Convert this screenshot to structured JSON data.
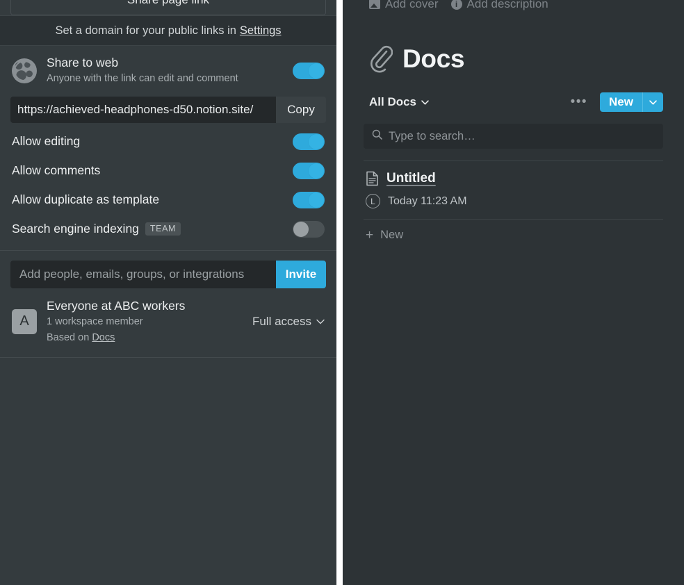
{
  "share_panel": {
    "share_page_link_label": "Share page link",
    "domain_banner": {
      "text": "Set a domain for your public links in",
      "link_label": "Settings"
    },
    "share_to_web": {
      "title": "Share to web",
      "subtitle": "Anyone with the link can edit and comment",
      "icon": "globe-icon",
      "toggle_state": "on"
    },
    "public_url": {
      "value": "https://achieved-headphones-d50.notion.site/",
      "copy_label": "Copy"
    },
    "options": [
      {
        "label": "Allow editing",
        "toggle_state": "on",
        "badge": ""
      },
      {
        "label": "Allow comments",
        "toggle_state": "on",
        "badge": ""
      },
      {
        "label": "Allow duplicate as template",
        "toggle_state": "on",
        "badge": ""
      },
      {
        "label": "Search engine indexing",
        "toggle_state": "off",
        "badge": "TEAM"
      }
    ],
    "invite": {
      "placeholder": "Add people, emails, groups, or integrations",
      "value": "",
      "button_label": "Invite"
    },
    "people": [
      {
        "avatar_initial": "A",
        "name": "Everyone at ABC workers",
        "sub_line1": "1 workspace member",
        "sub_line2_prefix": "Based on",
        "sub_line2_link": "Docs",
        "access_label": "Full access"
      }
    ],
    "accent_color": "#2eaadc"
  },
  "docs_panel": {
    "add_cover_label": "Add cover",
    "add_description_label": "Add description",
    "page_icon": "paperclip-icon",
    "title": "Docs",
    "view_label": "All Docs",
    "more_label": "•••",
    "new_button_label": "New",
    "search": {
      "placeholder": "Type to search…",
      "value": ""
    },
    "documents": [
      {
        "icon": "document-icon",
        "title": "Untitled",
        "author_initial": "L",
        "timestamp": "Today 11:23 AM"
      }
    ],
    "new_row_label": "New",
    "accent_color": "#2eaadc"
  }
}
